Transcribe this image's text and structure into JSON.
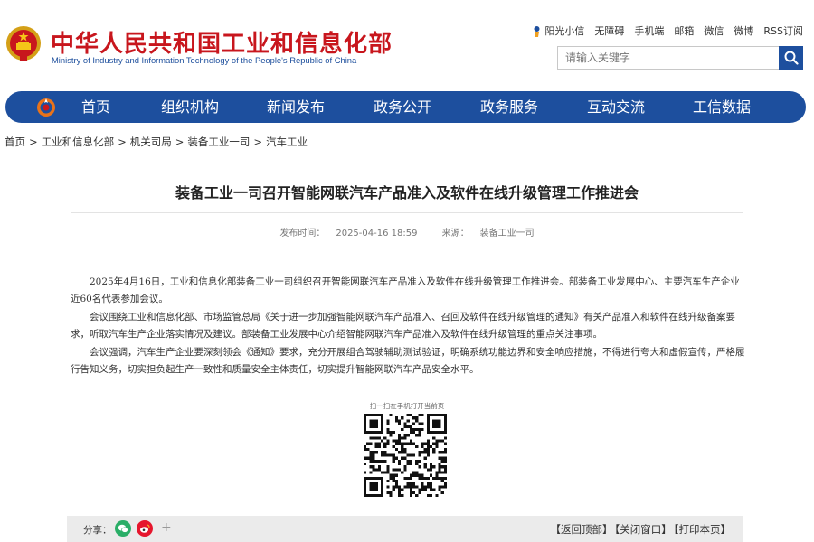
{
  "header": {
    "title_cn": "中华人民共和国工业和信息化部",
    "title_en": "Ministry of Industry and Information Technology of the People's Republic of China",
    "top_links": [
      "阳光小信",
      "无障碍",
      "手机端",
      "邮箱",
      "微信",
      "微博",
      "RSS订阅"
    ],
    "search_placeholder": "请输入关键字",
    "search_icon": "search-icon",
    "emblem_icon": "national-emblem-icon"
  },
  "nav": {
    "items": [
      "首页",
      "组织机构",
      "新闻发布",
      "政务公开",
      "政务服务",
      "互动交流",
      "工信数据"
    ]
  },
  "breadcrumb": [
    "首页",
    "工业和信息化部",
    "机关司局",
    "装备工业一司",
    "汽车工业"
  ],
  "article": {
    "title": "装备工业一司召开智能网联汽车产品准入及软件在线升级管理工作推进会",
    "publish_label": "发布时间：",
    "publish_time": "2025-04-16 18:59",
    "source_label": "来源：",
    "source": "装备工业一司",
    "paragraphs": [
      "2025年4月16日，工业和信息化部装备工业一司组织召开智能网联汽车产品准入及软件在线升级管理工作推进会。部装备工业发展中心、主要汽车生产企业近60名代表参加会议。",
      "会议围绕工业和信息化部、市场监管总局《关于进一步加强智能网联汽车产品准入、召回及软件在线升级管理的通知》有关产品准入和软件在线升级备案要求，听取汽车生产企业落实情况及建议。部装备工业发展中心介绍智能网联汽车产品准入及软件在线升级管理的重点关注事项。",
      "会议强调，汽车生产企业要深刻领会《通知》要求，充分开展组合驾驶辅助测试验证，明确系统功能边界和安全响应措施，不得进行夸大和虚假宣传，严格履行告知义务，切实担负起生产一致性和质量安全主体责任，切实提升智能网联汽车产品安全水平。"
    ],
    "qr_caption": "扫一扫在手机打开当前页"
  },
  "footer": {
    "share_label": "分享：",
    "share_icons": [
      "wechat-icon",
      "weibo-icon"
    ],
    "more": "+",
    "links": [
      "【返回顶部】",
      "【关闭窗口】",
      "【打印本页】"
    ]
  },
  "colors": {
    "brand_red": "#c8161d",
    "brand_blue": "#1d4f9e",
    "wechat_green": "#2aae67",
    "weibo_red": "#e6162d"
  }
}
